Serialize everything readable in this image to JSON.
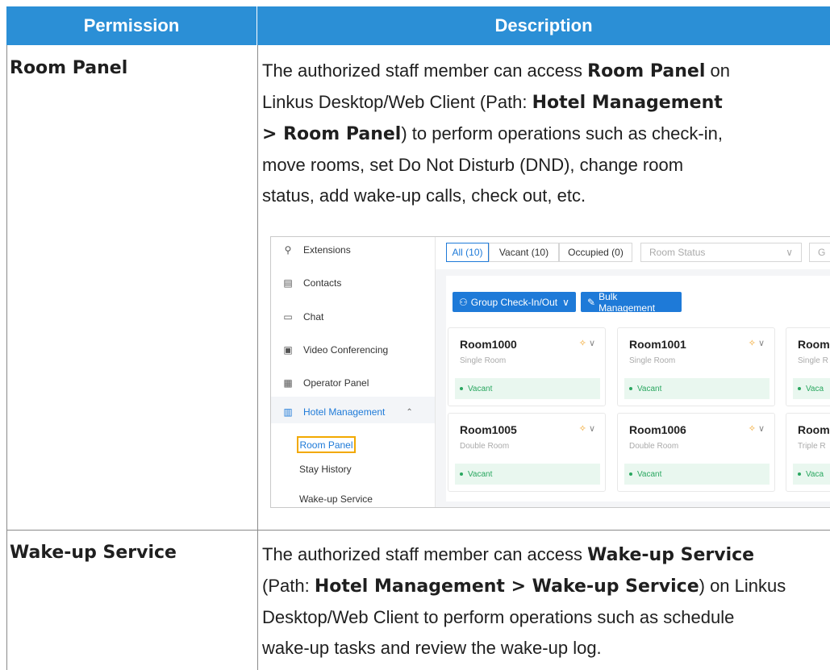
{
  "table": {
    "header": {
      "col1": "Permission",
      "col2": "Description"
    },
    "rows": [
      {
        "permission": "Room Panel",
        "description": {
          "l1a": "The authorized staff member can access ",
          "l1b": "Room Panel",
          "l1c": " on",
          "l2a": "Linkus Desktop/Web Client (Path: ",
          "l2b": "Hotel Management",
          "l3a": "> Room Panel",
          "l3b": ") to perform operations such as check-in,",
          "l4": "move rooms, set Do Not Disturb (DND), change room",
          "l5": "status, add wake-up calls, check out, etc."
        }
      },
      {
        "permission": "Wake-up Service",
        "description": {
          "l1a": "The authorized staff member can access ",
          "l1b": "Wake-up Service",
          "l2a": "(Path: ",
          "l2b": "Hotel Management > Wake-up Service",
          "l2c": ") on Linkus",
          "l3": "Desktop/Web Client to perform operations such as schedule",
          "l4": "wake-up tasks and review the wake-up log."
        }
      }
    ]
  },
  "screenshot": {
    "sidebar": {
      "items": [
        {
          "label": "Extensions",
          "icon": "extensions-icon"
        },
        {
          "label": "Contacts",
          "icon": "contacts-icon"
        },
        {
          "label": "Chat",
          "icon": "chat-icon"
        },
        {
          "label": "Video Conferencing",
          "icon": "video-conferencing-icon"
        },
        {
          "label": "Operator Panel",
          "icon": "operator-panel-icon"
        },
        {
          "label": "Hotel Management",
          "icon": "hotel-management-icon"
        }
      ],
      "sub_items": [
        "Room Panel",
        "Stay History",
        "Wake-up Service"
      ]
    },
    "tabs": [
      "All (10)",
      "Vacant (10)",
      "Occupied (0)"
    ],
    "filters": [
      "Room Status",
      "G"
    ],
    "buttons": {
      "group": "Group Check-In/Out",
      "bulk": "Bulk Management"
    },
    "cards": [
      {
        "room": "Room1000",
        "type": "Single Room",
        "status": "Vacant"
      },
      {
        "room": "Room1001",
        "type": "Single Room",
        "status": "Vacant"
      },
      {
        "room": "Room",
        "type": "Single R",
        "status": "Vaca"
      },
      {
        "room": "Room1005",
        "type": "Double Room",
        "status": "Vacant"
      },
      {
        "room": "Room1006",
        "type": "Double Room",
        "status": "Vacant"
      },
      {
        "room": "Room",
        "type": "Triple R",
        "status": "Vaca"
      }
    ],
    "colors": {
      "accent": "#1e7ad8",
      "header": "#2b8fd6",
      "highlight": "#f2a900",
      "vacant": "#2aa760"
    }
  }
}
